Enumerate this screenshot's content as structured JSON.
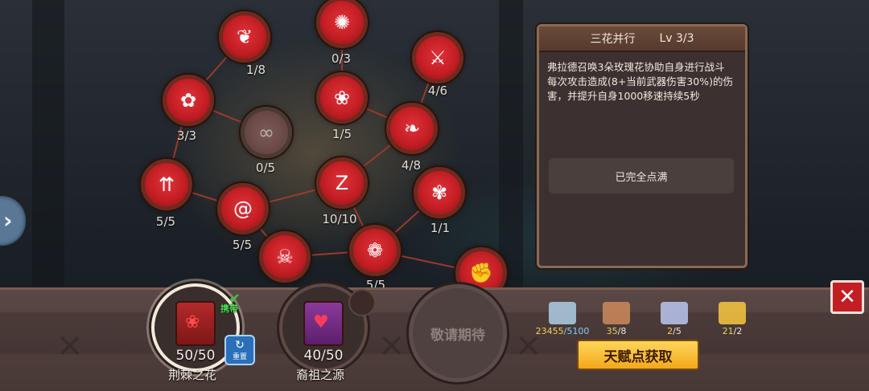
{
  "side_handle": {
    "icon": "chevron-right-icon",
    "glyph": "›"
  },
  "nodes": [
    {
      "id": "heart",
      "level": "1/8",
      "glyph": "❦",
      "icon": "heart-swirl-icon",
      "locked": false
    },
    {
      "id": "sun",
      "level": "0/3",
      "glyph": "✺",
      "icon": "sun-icon",
      "locked": false
    },
    {
      "id": "sword",
      "level": "4/6",
      "glyph": "⚔",
      "icon": "thorn-sword-icon",
      "locked": false
    },
    {
      "id": "rose-burst",
      "level": "3/3",
      "glyph": "✿",
      "icon": "rose-burst-icon",
      "locked": false
    },
    {
      "id": "whip",
      "level": "0/5",
      "glyph": "∞",
      "icon": "whip-icon",
      "locked": true
    },
    {
      "id": "flower-bowl",
      "level": "1/5",
      "glyph": "❀",
      "icon": "flower-bowl-icon",
      "locked": false
    },
    {
      "id": "vine",
      "level": "4/8",
      "glyph": "❧",
      "icon": "vine-icon",
      "locked": false
    },
    {
      "id": "arrows-rose",
      "level": "5/5",
      "glyph": "⇈",
      "icon": "arrows-up-icon",
      "locked": false
    },
    {
      "id": "spiral-rose",
      "level": "5/5",
      "glyph": "@",
      "icon": "spiral-rose-icon",
      "locked": false
    },
    {
      "id": "sleep",
      "level": "10/10",
      "glyph": "Z",
      "icon": "sleep-icon",
      "locked": false
    },
    {
      "id": "single-rose",
      "level": "1/1",
      "glyph": "✾",
      "icon": "single-rose-icon",
      "locked": false
    },
    {
      "id": "skull",
      "level": "",
      "glyph": "☠",
      "icon": "skull-icon",
      "locked": false
    },
    {
      "id": "petals",
      "level": "5/5",
      "glyph": "❁",
      "icon": "petals-icon",
      "locked": false
    },
    {
      "id": "fist",
      "level": "",
      "glyph": "✊",
      "icon": "fist-icon",
      "locked": false
    }
  ],
  "detail": {
    "name": "三花并行",
    "level": "Lv 3/3",
    "description": [
      "弗拉德召唤3朵玫瑰花协助自身进行战斗",
      "每次攻击造成(8+当前武器伤害30%)的伤",
      "害，并提升自身1000移速持续5秒"
    ],
    "status": "已完全点满"
  },
  "books": [
    {
      "count": "50/50",
      "name": "荆棘之花",
      "active": true,
      "icon": "rose-book-icon"
    },
    {
      "count": "40/50",
      "name": "裔祖之源",
      "active": false,
      "icon": "blood-chalice-book-icon"
    }
  ],
  "locked_slot": {
    "label": "敬请期待"
  },
  "carry_badge": {
    "label": "携带",
    "icon": "check-icon"
  },
  "reset_button": {
    "label": "重置",
    "icon": "reset-icon"
  },
  "resources": [
    {
      "icon": "coin-stack-icon",
      "value": "23455",
      "max": "/5100",
      "color": "#a9c6dc"
    },
    {
      "icon": "bronze-badge-icon",
      "value": "35",
      "max": "/8",
      "color": "#c7855a"
    },
    {
      "icon": "silver-badge-icon",
      "value": "2",
      "max": "/5",
      "color": "#b5bfe6"
    },
    {
      "icon": "gold-badge-icon",
      "value": "21",
      "max": "/2",
      "color": "#f0c040"
    }
  ],
  "get_points_button": "天赋点获取",
  "close_button": {
    "icon": "close-icon",
    "glyph": "✕"
  }
}
